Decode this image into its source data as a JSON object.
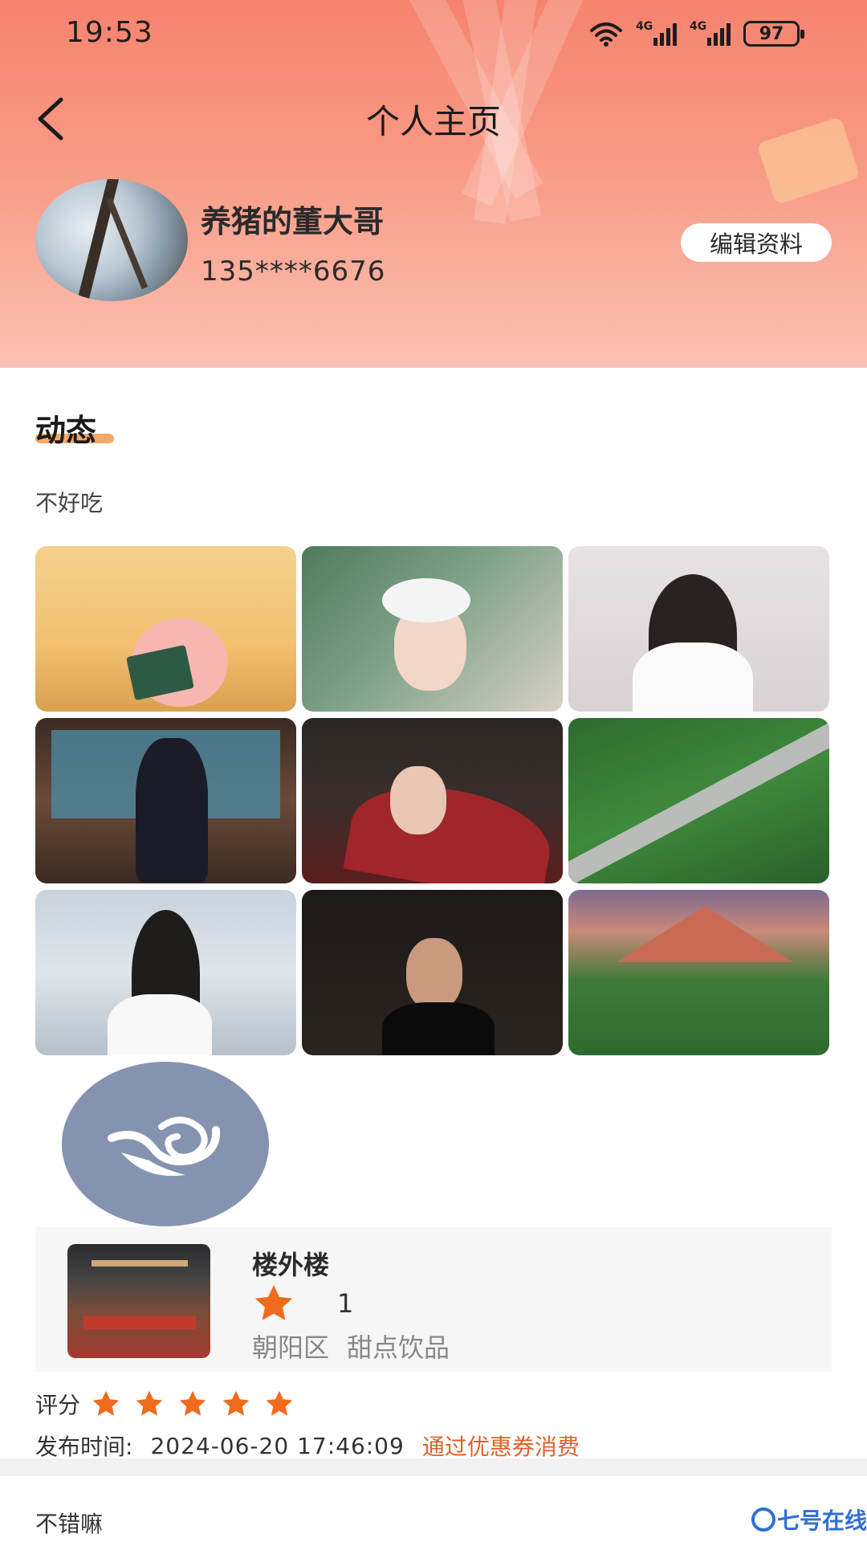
{
  "status_bar": {
    "time": "19:53",
    "network_1": "4G",
    "network_2": "4G",
    "battery": "97"
  },
  "nav": {
    "title": "个人主页"
  },
  "profile": {
    "name": "养猪的董大哥",
    "phone": "135****6676",
    "edit_label": "编辑资料"
  },
  "feed": {
    "section_title": "动态",
    "post_text": "不好吃",
    "gallery_count": 9
  },
  "shop": {
    "name": "楼外楼",
    "rating": "1",
    "district": "朝阳区",
    "category": "甜点饮品"
  },
  "review": {
    "score_label": "评分",
    "score": 5,
    "publish_label": "发布时间:",
    "publish_time": "2024-06-20 17:46:09",
    "tag": "通过优惠券消费"
  },
  "next_post": {
    "text": "不错嘛"
  },
  "watermark": {
    "text": "七号在线"
  },
  "colors": {
    "header_top": "#f6836e",
    "accent_orange": "#f06b1c",
    "tag_orange": "#e0602a",
    "logo_bg": "#8593b0"
  }
}
